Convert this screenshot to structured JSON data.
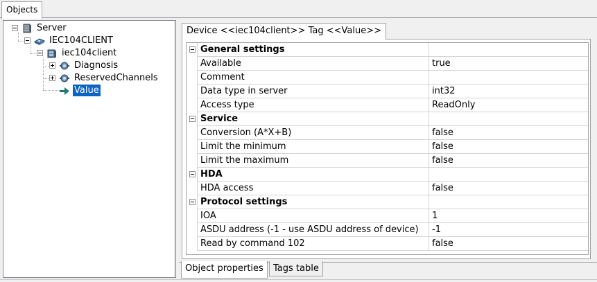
{
  "top_tabs": {
    "objects": "Objects"
  },
  "tree": {
    "server": {
      "label": "Server",
      "icon": "server-icon"
    },
    "iec104client_device": {
      "label": "IEC104CLIENT",
      "icon": "network-device-icon"
    },
    "iec104client_node": {
      "label": "iec104client",
      "icon": "module-icon"
    },
    "diagnosis": {
      "label": "Diagnosis",
      "icon": "tag-group-icon"
    },
    "reserved_channels": {
      "label": "ReservedChannels",
      "icon": "tag-group-icon"
    },
    "value": {
      "label": "Value",
      "icon": "tag-arrow-icon"
    }
  },
  "property_tab": {
    "label": "Device <<iec104client>> Tag <<Value>>"
  },
  "grid": {
    "general": {
      "title": "General settings",
      "rows": [
        {
          "name": "Available",
          "value": "true"
        },
        {
          "name": "Comment",
          "value": ""
        },
        {
          "name": "Data type in server",
          "value": "int32"
        },
        {
          "name": "Access type",
          "value": "ReadOnly"
        }
      ]
    },
    "service": {
      "title": "Service",
      "rows": [
        {
          "name": "Conversion (A*X+B)",
          "value": "false"
        },
        {
          "name": "Limit the minimum",
          "value": "false"
        },
        {
          "name": "Limit the maximum",
          "value": "false"
        }
      ]
    },
    "hda": {
      "title": "HDA",
      "rows": [
        {
          "name": "HDA access",
          "value": "false"
        }
      ]
    },
    "protocol": {
      "title": "Protocol settings",
      "rows": [
        {
          "name": "IOA",
          "value": "1"
        },
        {
          "name": "ASDU address (-1 - use ASDU address of device)",
          "value": "-1"
        },
        {
          "name": "Read by command 102",
          "value": "false"
        }
      ]
    }
  },
  "bottom_tabs": {
    "object_properties": "Object properties",
    "tags_table": "Tags table"
  },
  "colors": {
    "selection": "#0a64c8",
    "grid_lines": "#d4d4d4"
  }
}
